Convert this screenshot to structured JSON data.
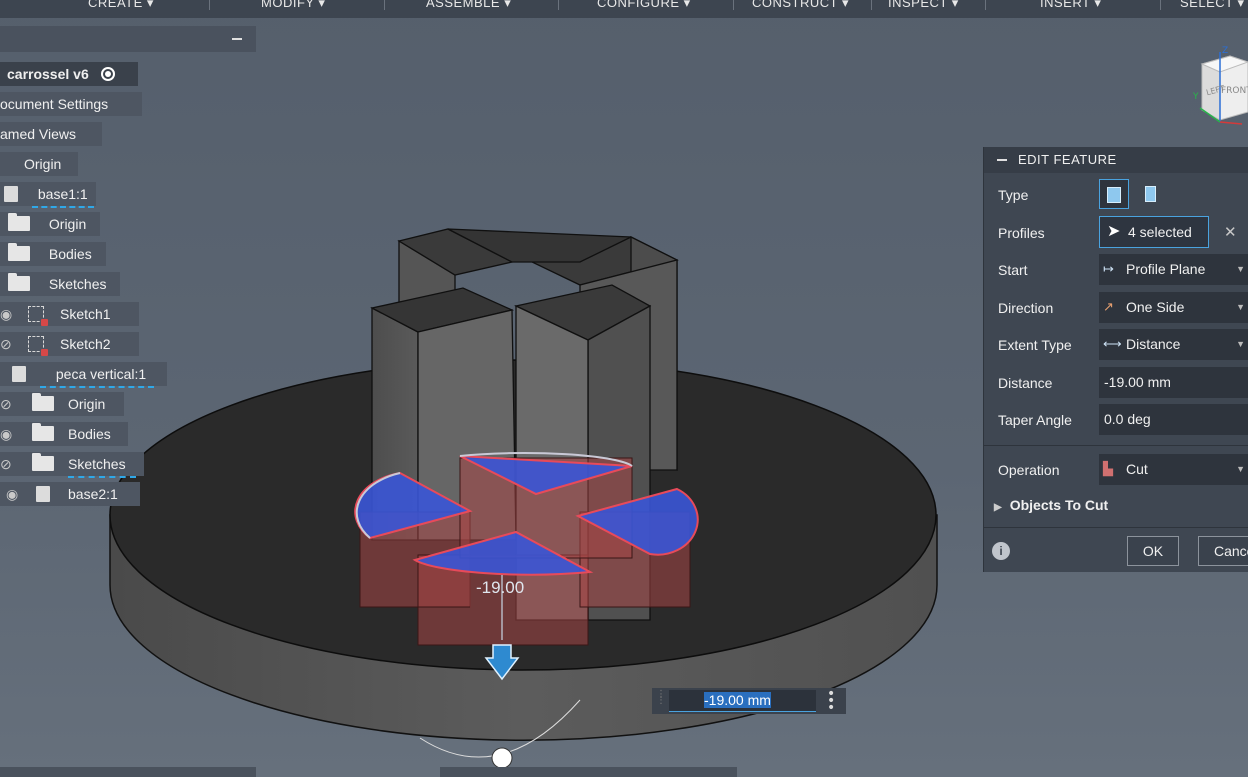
{
  "toolbar": {
    "items": [
      "CREATE ▾",
      "MODIFY ▾",
      "ASSEMBLE ▾",
      "CONFIGURE ▾",
      "CONSTRUCT ▾",
      "INSPECT ▾",
      "INSERT ▾",
      "SELECT ▾"
    ]
  },
  "browser": {
    "root": "carrossel v6",
    "document_settings": "ocument Settings",
    "named_views": "amed Views",
    "origin": "Origin",
    "base1": "base1:1",
    "base1_origin": "Origin",
    "base1_bodies": "Bodies",
    "base1_sketches": "Sketches",
    "sketch1": "Sketch1",
    "sketch2": "Sketch2",
    "peca": "peca vertical:1",
    "peca_origin": "Origin",
    "peca_bodies": "Bodies",
    "peca_sketches": "Sketches",
    "base2": "base2:1"
  },
  "viewport": {
    "dimension_label": "-19.00",
    "dimension_input": "-19.00 mm",
    "viewcube_labels": [
      "LEFT",
      "FRONT"
    ],
    "axes": [
      "Z",
      "Y"
    ]
  },
  "edit_feature": {
    "title": "EDIT FEATURE",
    "type_label": "Type",
    "profiles_label": "Profiles",
    "profiles_value": "4 selected",
    "start_label": "Start",
    "start_value": "Profile Plane",
    "direction_label": "Direction",
    "direction_value": "One Side",
    "extent_type_label": "Extent Type",
    "extent_type_value": "Distance",
    "distance_label": "Distance",
    "distance_value": "-19.00 mm",
    "taper_label": "Taper Angle",
    "taper_value": "0.0 deg",
    "operation_label": "Operation",
    "operation_value": "Cut",
    "objects_to_cut": "Objects To Cut",
    "ok": "OK",
    "cancel": "Cance"
  },
  "colors": {
    "accent": "#4aa3df",
    "profile_fill": "#3b56d4",
    "cut_preview": "#b94848",
    "body": "#6e6e6e"
  },
  "icons": [
    "collapse-icon",
    "eye-icon",
    "eye-hidden-icon",
    "folder-icon",
    "sketch-icon",
    "component-icon",
    "radio-icon",
    "viewcube-icon",
    "extrude-icon",
    "cursor-icon",
    "close-icon",
    "caret-down-icon",
    "info-icon",
    "arrow-down-icon",
    "kebab-icon"
  ]
}
